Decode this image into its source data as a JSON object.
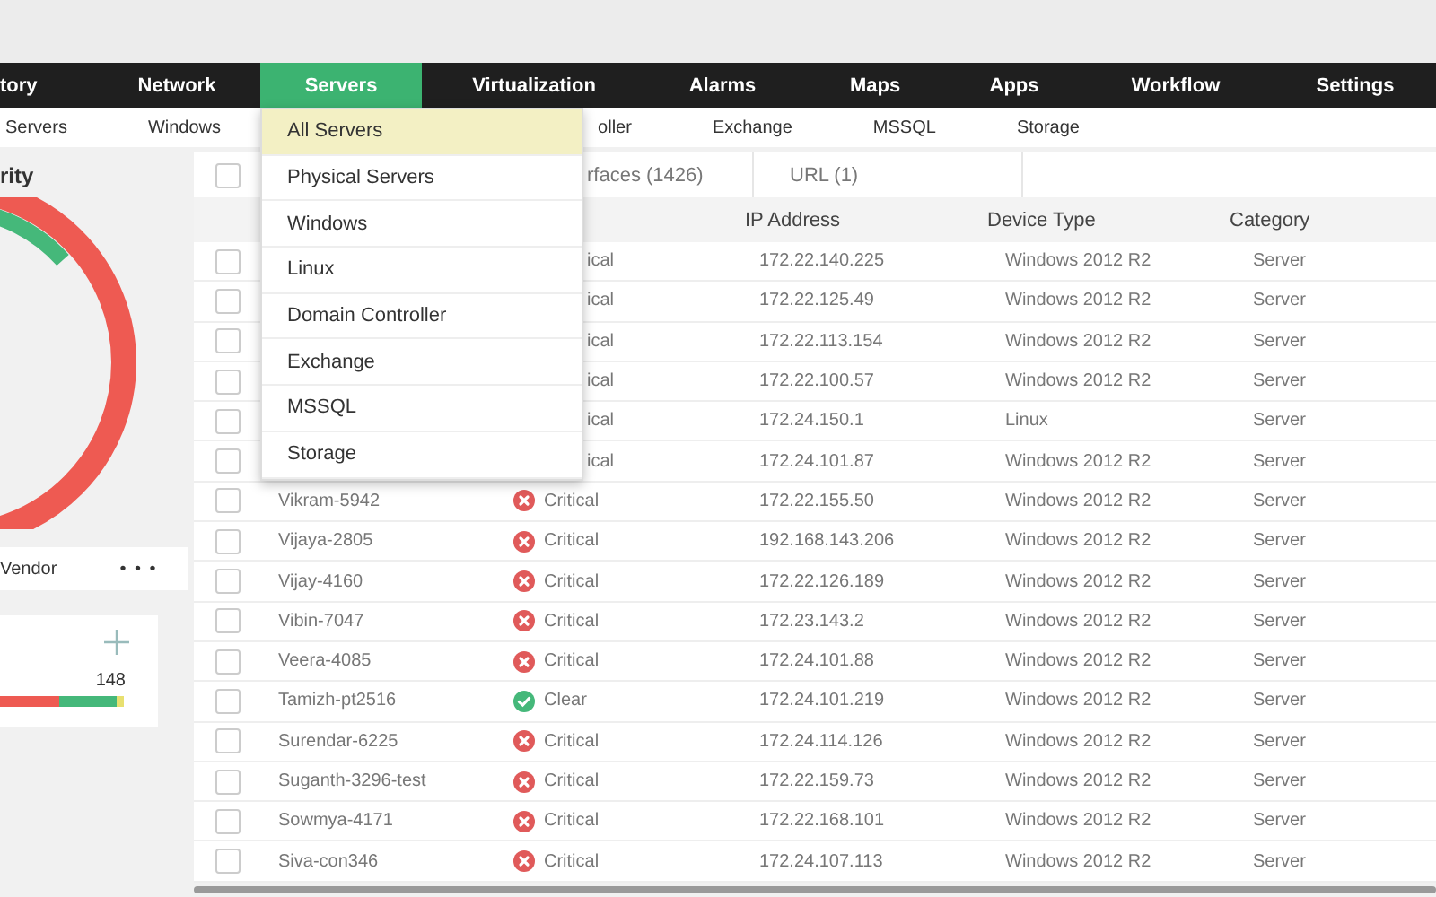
{
  "nav": {
    "items": [
      {
        "label": "tory",
        "selected": false
      },
      {
        "label": "Network",
        "selected": false
      },
      {
        "label": "Servers",
        "selected": true
      },
      {
        "label": "Virtualization",
        "selected": false
      },
      {
        "label": "Alarms",
        "selected": false
      },
      {
        "label": "Maps",
        "selected": false
      },
      {
        "label": "Apps",
        "selected": false
      },
      {
        "label": "Workflow",
        "selected": false
      },
      {
        "label": "Settings",
        "selected": false
      }
    ]
  },
  "subnav": {
    "items": [
      {
        "label": "Servers",
        "kind": "plain"
      },
      {
        "label": "Windows",
        "kind": "plain"
      },
      {
        "label": "oller",
        "kind": "partly_hidden"
      },
      {
        "label": "Exchange",
        "kind": "plain"
      },
      {
        "label": "MSSQL",
        "kind": "plain"
      },
      {
        "label": "Storage",
        "kind": "plain"
      }
    ]
  },
  "dropdown": {
    "items": [
      {
        "label": "All Servers",
        "selected": true
      },
      {
        "label": "Physical Servers",
        "selected": false
      },
      {
        "label": "Windows",
        "selected": false
      },
      {
        "label": "Linux",
        "selected": false
      },
      {
        "label": "Domain Controller",
        "selected": false
      },
      {
        "label": "Exchange",
        "selected": false
      },
      {
        "label": "MSSQL",
        "selected": false
      },
      {
        "label": "Storage",
        "selected": false
      }
    ]
  },
  "left_panel": {
    "title": "rity",
    "tabs": [
      {
        "label": "Vendor"
      },
      {
        "label": "• • •"
      }
    ],
    "card": {
      "value": "148"
    }
  },
  "table": {
    "select_all": {
      "checked": false
    },
    "tabs": [
      {
        "label": "rfaces (1426)",
        "kind": "partly_hidden"
      },
      {
        "label": "URL (1)",
        "kind": "plain"
      }
    ],
    "columns": [
      "IP Address",
      "Device Type",
      "Category"
    ],
    "rows": [
      {
        "kind": "partly_hidden",
        "checked": false,
        "status_text": "ical",
        "ip": "172.22.140.225",
        "type": "Windows 2012 R2",
        "category": "Server"
      },
      {
        "kind": "partly_hidden",
        "checked": false,
        "status_text": "ical",
        "ip": "172.22.125.49",
        "type": "Windows 2012 R2",
        "category": "Server"
      },
      {
        "kind": "partly_hidden",
        "checked": false,
        "status_text": "ical",
        "ip": "172.22.113.154",
        "type": "Windows 2012 R2",
        "category": "Server"
      },
      {
        "kind": "partly_hidden",
        "checked": false,
        "status_text": "ical",
        "ip": "172.22.100.57",
        "type": "Windows 2012 R2",
        "category": "Server"
      },
      {
        "kind": "partly_hidden",
        "checked": false,
        "status_text": "ical",
        "ip": "172.24.150.1",
        "type": "Linux",
        "category": "Server"
      },
      {
        "kind": "partly_hidden",
        "checked": false,
        "status_text": "ical",
        "ip": "172.24.101.87",
        "type": "Windows 2012 R2",
        "category": "Server"
      },
      {
        "kind": "critical",
        "checked": false,
        "name": "Vikram-5942",
        "status_text": "Critical",
        "ip": "172.22.155.50",
        "type": "Windows 2012 R2",
        "category": "Server"
      },
      {
        "kind": "critical",
        "checked": false,
        "name": "Vijaya-2805",
        "status_text": "Critical",
        "ip": "192.168.143.206",
        "type": "Windows 2012 R2",
        "category": "Server"
      },
      {
        "kind": "critical",
        "checked": false,
        "name": "Vijay-4160",
        "status_text": "Critical",
        "ip": "172.22.126.189",
        "type": "Windows 2012 R2",
        "category": "Server"
      },
      {
        "kind": "critical",
        "checked": false,
        "name": "Vibin-7047",
        "status_text": "Critical",
        "ip": "172.23.143.2",
        "type": "Windows 2012 R2",
        "category": "Server"
      },
      {
        "kind": "critical",
        "checked": false,
        "name": "Veera-4085",
        "status_text": "Critical",
        "ip": "172.24.101.88",
        "type": "Windows 2012 R2",
        "category": "Server"
      },
      {
        "kind": "clear",
        "checked": false,
        "name": "Tamizh-pt2516",
        "status_text": "Clear",
        "ip": "172.24.101.219",
        "type": "Windows 2012 R2",
        "category": "Server"
      },
      {
        "kind": "critical",
        "checked": false,
        "name": "Surendar-6225",
        "status_text": "Critical",
        "ip": "172.24.114.126",
        "type": "Windows 2012 R2",
        "category": "Server"
      },
      {
        "kind": "critical",
        "checked": false,
        "name": "Suganth-3296-test",
        "status_text": "Critical",
        "ip": "172.22.159.73",
        "type": "Windows 2012 R2",
        "category": "Server"
      },
      {
        "kind": "critical",
        "checked": false,
        "name": "Sowmya-4171",
        "status_text": "Critical",
        "ip": "172.22.168.101",
        "type": "Windows 2012 R2",
        "category": "Server"
      },
      {
        "kind": "critical",
        "checked": false,
        "name": "Siva-con346",
        "status_text": "Critical",
        "ip": "172.24.107.113",
        "type": "Windows 2012 R2",
        "category": "Server"
      }
    ]
  }
}
